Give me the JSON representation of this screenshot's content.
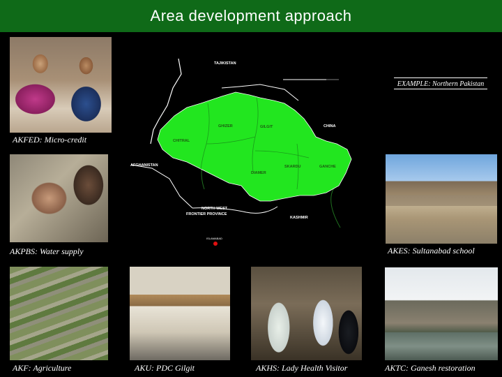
{
  "title": "Area development approach",
  "example_label": "EXAMPLE: Northern Pakistan",
  "captions": {
    "micro_credit": "AKFED: Micro-credit",
    "water_supply": "AKPBS: Water supply",
    "school": "AKES: Sultanabad school",
    "agriculture": "AKF: Agriculture",
    "pdc": "AKU: PDC Gilgit",
    "lhv": "AKHS: Lady Health Visitor",
    "restoration": "AKTC: Ganesh restoration"
  },
  "map": {
    "labels": {
      "tajikistan": "TAJIKISTAN",
      "china": "CHINA",
      "afghanistan": "AFGHANISTAN",
      "nwfp_line1": "NORTH WEST",
      "nwfp_line2": "FRONTIER PROVINCE",
      "kashmir": "KASHMIR",
      "islamabad": "ISLAMABAD",
      "ghizer": "GHIZER",
      "gilgit": "GILGIT",
      "chitral": "CHITRAL",
      "skardu": "SKARDU",
      "ganche": "GANCHE",
      "diamer": "DIAMER"
    },
    "colors": {
      "region": "#22e61f",
      "border": "#ffffff",
      "river": "#1f6f1f",
      "capital": "#e01010"
    }
  },
  "colors": {
    "title_bar": "#0f6a18",
    "background": "#000000",
    "caption_text": "#ffffff"
  }
}
